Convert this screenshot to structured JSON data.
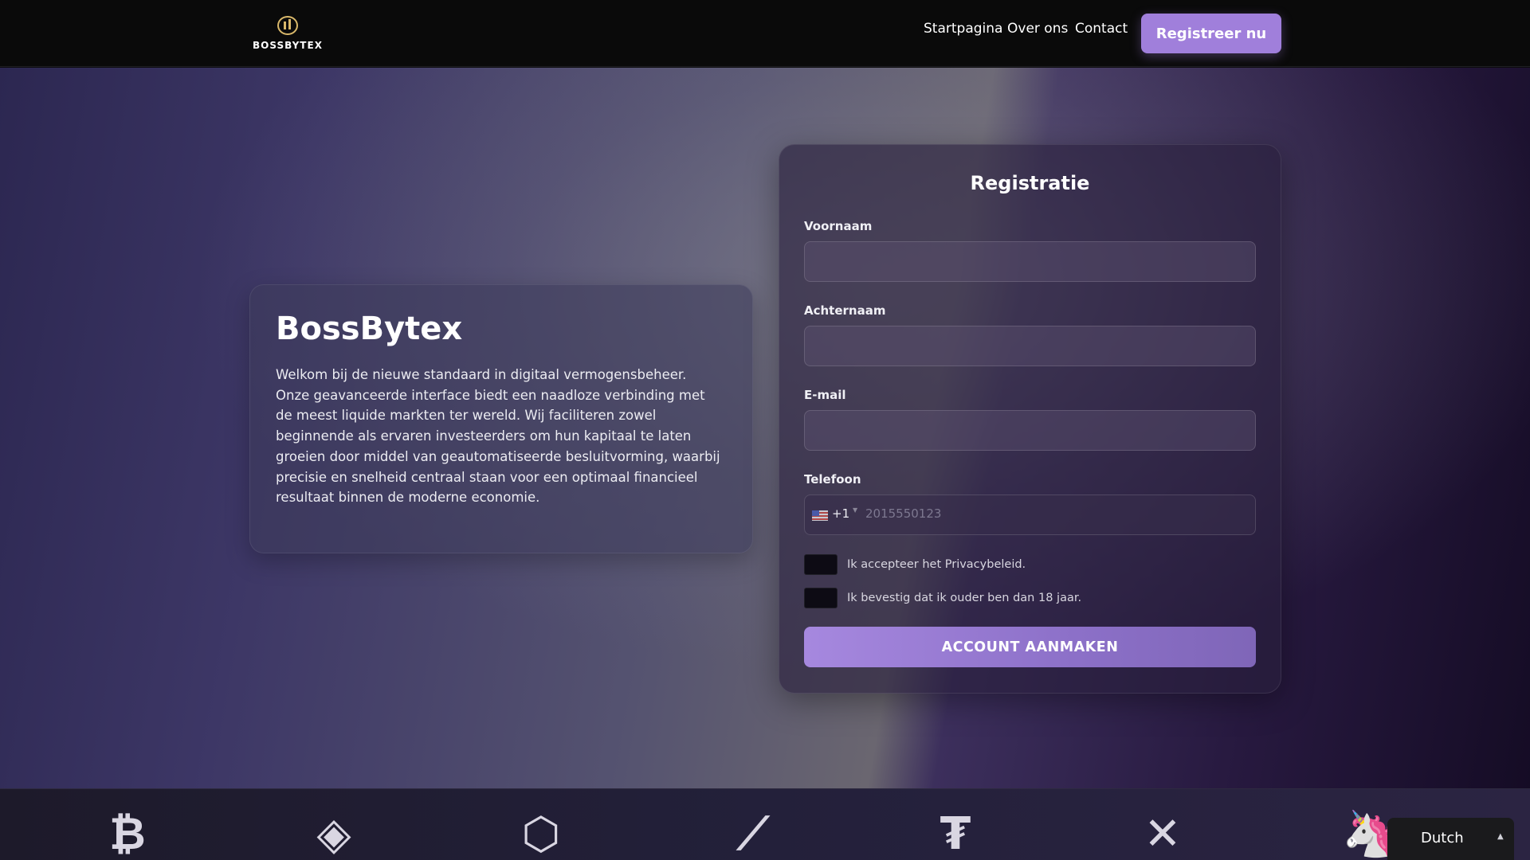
{
  "header": {
    "logo_text": "BOSSBYTEX",
    "nav": [
      "Startpagina",
      "Over ons",
      "Contact"
    ],
    "cta_label": "Registreer nu"
  },
  "info": {
    "title": "BossBytex",
    "text": "Welkom bij de nieuwe standaard in digitaal vermogensbeheer. Onze geavanceerde interface biedt een naadloze verbinding met de meest liquide markten ter wereld. Wij faciliteren zowel beginnende als ervaren investeerders om hun kapitaal te laten groeien door middel van geautomatiseerde besluitvorming, waarbij precisie en snelheid centraal staan voor een optimaal financieel resultaat binnen de moderne economie."
  },
  "form": {
    "title": "Registratie",
    "first_name_label": "Voornaam",
    "first_name_value": "",
    "last_name_label": "Achternaam",
    "last_name_value": "",
    "email_label": "E-mail",
    "email_value": "",
    "phone_label": "Telefoon",
    "phone_dial": "+1",
    "phone_placeholder": "2015550123",
    "privacy_label": "Ik accepteer het Privacybeleid.",
    "age_label": "Ik bevestig dat ik ouder ben dan 18 jaar.",
    "submit_label": "ACCOUNT AANMAKEN"
  },
  "coins": [
    "bitcoin-icon",
    "binance-icon",
    "chainlink-icon",
    "stacks-icon",
    "tether-icon",
    "xrp-icon",
    "uniswap-icon"
  ],
  "language": {
    "selected": "Dutch"
  },
  "colors": {
    "accent": "#a07fdb",
    "header_bg": "#0a0a0a"
  }
}
